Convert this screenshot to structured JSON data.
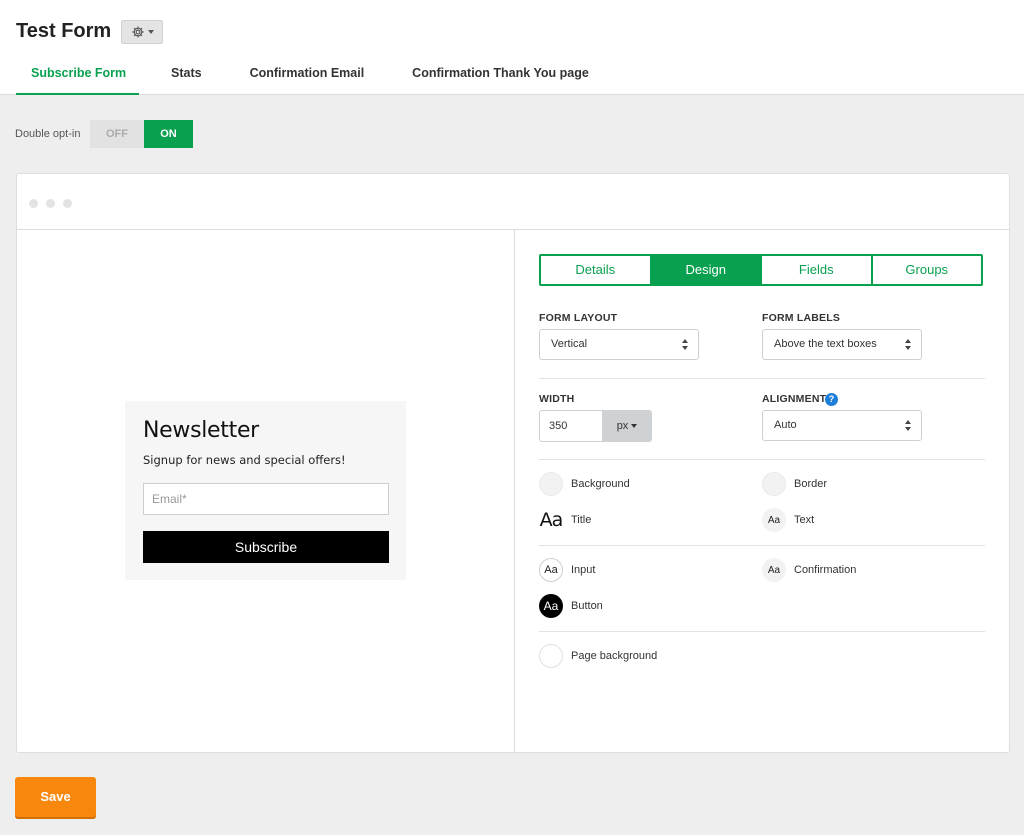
{
  "header": {
    "title": "Test Form",
    "tabs": [
      {
        "label": "Subscribe Form",
        "active": true
      },
      {
        "label": "Stats",
        "active": false
      },
      {
        "label": "Confirmation Email",
        "active": false
      },
      {
        "label": "Confirmation Thank You page",
        "active": false
      }
    ]
  },
  "optin": {
    "label": "Double opt-in",
    "off_label": "OFF",
    "on_label": "ON",
    "value": "ON"
  },
  "preview": {
    "title": "Newsletter",
    "subtitle": "Signup for news and special offers!",
    "email_placeholder": "Email*",
    "button_label": "Subscribe"
  },
  "settings": {
    "tabs": [
      {
        "label": "Details",
        "active": false
      },
      {
        "label": "Design",
        "active": true
      },
      {
        "label": "Fields",
        "active": false
      },
      {
        "label": "Groups",
        "active": false
      }
    ],
    "form_layout": {
      "label": "FORM LAYOUT",
      "value": "Vertical"
    },
    "form_labels": {
      "label": "FORM LABELS",
      "value": "Above the text boxes"
    },
    "width": {
      "label": "WIDTH",
      "value": "350",
      "unit": "px"
    },
    "alignment": {
      "label": "ALIGNMENT",
      "value": "Auto",
      "help": "?"
    },
    "styles": {
      "background": "Background",
      "border": "Border",
      "title": "Title",
      "text": "Text",
      "input": "Input",
      "confirmation": "Confirmation",
      "button": "Button",
      "page_background": "Page background",
      "swatch_glyph": "Aa"
    }
  },
  "footer": {
    "save_label": "Save"
  },
  "colors": {
    "brand_green": "#09a150",
    "save_orange": "#f7870d",
    "help_blue": "#1c7ed6"
  }
}
